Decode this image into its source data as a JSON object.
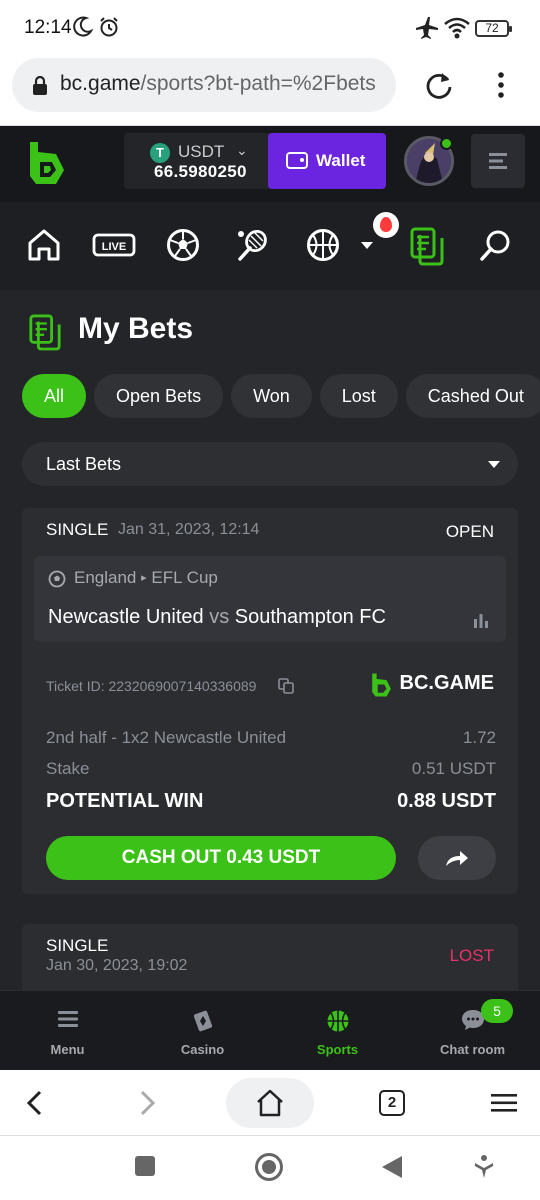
{
  "status_bar": {
    "time": "12:14",
    "battery": "72"
  },
  "browser": {
    "url_host": "bc.game",
    "url_path": "/sports?bt-path=%2Fbets",
    "tab_count": "2"
  },
  "header": {
    "currency": "USDT",
    "balance": "66.5980250",
    "wallet_label": "Wallet"
  },
  "page": {
    "title": "My Bets",
    "filters": [
      {
        "label": "All",
        "active": true
      },
      {
        "label": "Open Bets",
        "active": false
      },
      {
        "label": "Won",
        "active": false
      },
      {
        "label": "Lost",
        "active": false
      },
      {
        "label": "Cashed Out",
        "active": false
      }
    ],
    "period_select": "Last Bets"
  },
  "bets": [
    {
      "type": "SINGLE",
      "date": "Jan 31, 2023, 12:14",
      "status": "OPEN",
      "country": "England",
      "league": "EFL Cup",
      "home": "Newcastle United",
      "vs": "vs",
      "away": "Southampton FC",
      "ticket": "Ticket ID: 2232069007140336089",
      "brand": "BC.GAME",
      "selection": "2nd half - 1x2 Newcastle United",
      "odds": "1.72",
      "stake_label": "Stake",
      "stake": "0.51 USDT",
      "potential_label": "POTENTIAL WIN",
      "potential": "0.88 USDT",
      "cashout_label": "CASH OUT 0.43 USDT"
    },
    {
      "type": "SINGLE",
      "date": "Jan 30, 2023, 19:02",
      "status": "LOST"
    }
  ],
  "app_nav": {
    "tabs": [
      {
        "label": "Menu",
        "icon": "menu-icon"
      },
      {
        "label": "Casino",
        "icon": "casino-icon"
      },
      {
        "label": "Sports",
        "icon": "basketball-icon"
      },
      {
        "label": "Chat room",
        "icon": "chat-icon"
      }
    ],
    "chat_badge": "5"
  },
  "colors": {
    "accent_green": "#3bc117",
    "wallet_purple": "#6b25e0",
    "lost_pink": "#ed2f6a",
    "bg_dark": "#232529"
  }
}
